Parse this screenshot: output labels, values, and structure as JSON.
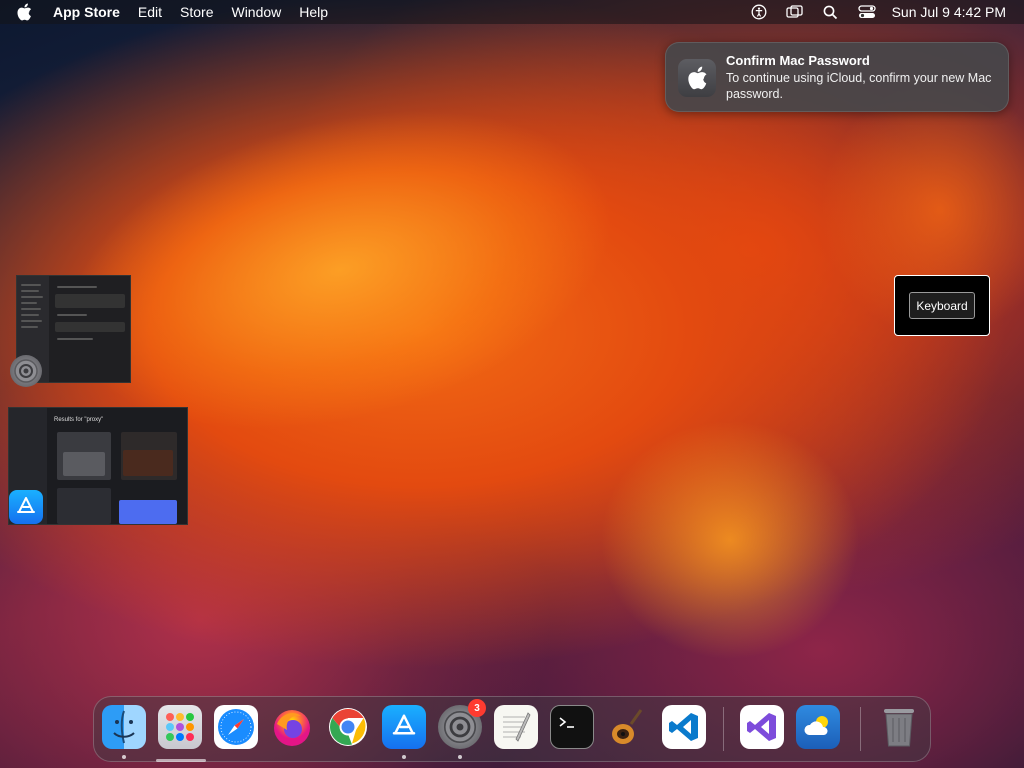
{
  "menubar": {
    "app_name": "App Store",
    "items": [
      "Edit",
      "Store",
      "Window",
      "Help"
    ],
    "clock": "Sun Jul 9  4:42 PM",
    "status_icons": [
      "accessibility-icon",
      "screen-mirroring-icon",
      "spotlight-search-icon",
      "control-center-icon"
    ]
  },
  "notification": {
    "title": "Confirm Mac Password",
    "body": "To continue using iCloud, confirm your new Mac password."
  },
  "keyboard_hud": {
    "label": "Keyboard"
  },
  "thumbnails": {
    "appstore_heading": "Results for \"proxy\""
  },
  "dock": {
    "items": [
      {
        "name": "Finder",
        "icon": "finder-icon",
        "running": true
      },
      {
        "name": "Launchpad",
        "icon": "launchpad-icon",
        "running": false
      },
      {
        "name": "Safari",
        "icon": "safari-icon",
        "running": false
      },
      {
        "name": "Firefox",
        "icon": "firefox-icon",
        "running": false
      },
      {
        "name": "Google Chrome",
        "icon": "chrome-icon",
        "running": false
      },
      {
        "name": "App Store",
        "icon": "app-store-icon",
        "running": true
      },
      {
        "name": "System Settings",
        "icon": "system-settings-icon",
        "running": true,
        "badge": "3"
      },
      {
        "name": "TextEdit",
        "icon": "textedit-icon",
        "running": false
      },
      {
        "name": "Terminal",
        "icon": "terminal-icon",
        "running": false
      },
      {
        "name": "GarageBand",
        "icon": "garageband-icon",
        "running": false
      },
      {
        "name": "Visual Studio Code",
        "icon": "vscode-icon",
        "running": false
      },
      {
        "name": "Visual Studio",
        "icon": "visual-studio-icon",
        "running": false
      },
      {
        "name": "Weather",
        "icon": "weather-icon",
        "running": false
      },
      {
        "name": "Trash",
        "icon": "trash-icon",
        "running": false
      }
    ]
  },
  "colors": {
    "badge": "#ff3b30",
    "app_store_blue": "#1570ef"
  }
}
